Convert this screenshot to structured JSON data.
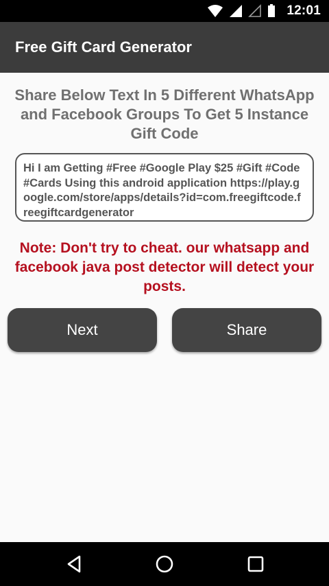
{
  "status_bar": {
    "time": "12:01",
    "icons": [
      "wifi-icon",
      "signal-icon",
      "signal-empty-icon",
      "battery-icon"
    ]
  },
  "app_bar": {
    "title": "Free Gift Card Generator"
  },
  "main": {
    "heading": "Share Below Text In 5 Different WhatsApp and Facebook Groups To Get 5 Instance Gift Code",
    "share_text": "Hi I am Getting #Free #Google Play $25  #Gift #Code #Cards Using this android application https://play.google.com/store/apps/details?id=com.freegiftcode.freegiftcardgenerator",
    "note": "Note: Don't try to cheat. our whatsapp and facebook java  post detector will detect your posts.",
    "next_label": "Next",
    "share_label": "Share"
  },
  "nav_bar": {
    "icons": [
      "back-icon",
      "home-icon",
      "recents-icon"
    ]
  },
  "colors": {
    "app_bar": "#3c3c3c",
    "heading": "#707070",
    "note": "#b5101f",
    "button": "#444444",
    "background": "#fafafa"
  }
}
